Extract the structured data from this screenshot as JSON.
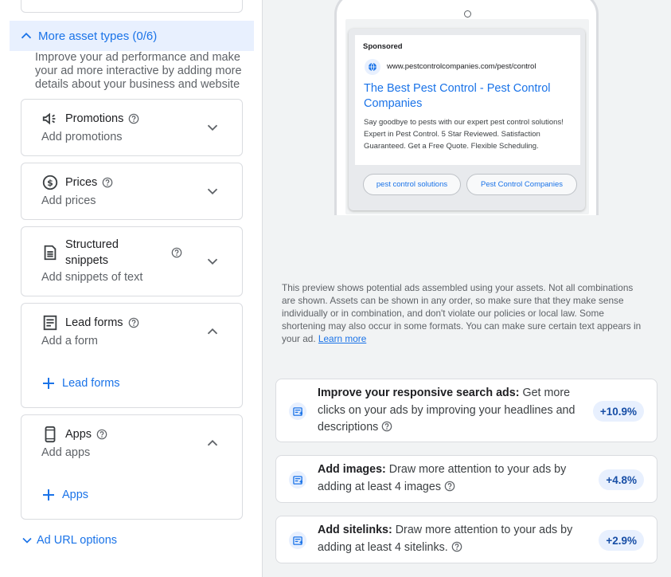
{
  "left": {
    "more_assets": {
      "label": "More asset types (0/6)",
      "description": "Improve your ad performance and make your ad more interactive by adding more details about your business and website"
    },
    "assets": [
      {
        "title": "Promotions",
        "sub": "Add promotions",
        "icon": "megaphone-icon"
      },
      {
        "title": "Prices",
        "sub": "Add prices",
        "icon": "dollar-circle-icon"
      },
      {
        "title": "Structured snippets",
        "sub": "Add snippets of text",
        "icon": "snippet-icon"
      },
      {
        "title": "Lead forms",
        "sub": "Add a form",
        "icon": "form-icon",
        "add_label": "Lead forms"
      },
      {
        "title": "Apps",
        "sub": "Add apps",
        "icon": "phone-icon",
        "add_label": "Apps"
      }
    ],
    "url_options": "Ad URL options"
  },
  "preview": {
    "sponsored": "Sponsored",
    "display_url": "www.pestcontrolcompanies.com/pest/control",
    "headline": "The Best Pest Control - Pest Control Companies",
    "description": "Say goodbye to pests with our expert pest control solutions! Expert in Pest Control. 5 Star Reviewed. Satisfaction Guaranteed. Get a Free Quote. Flexible Scheduling.",
    "sitelinks": [
      "pest control solutions",
      "Pest Control Companies"
    ],
    "disclaimer": "This preview shows potential ads assembled using your assets. Not all combinations are shown. Assets can be shown in any order, so make sure that they make sense individually or in combination, and don't violate our policies or local law. Some shortening may also occur in some formats. You can make sure certain text appears in your ad.",
    "learn_more": "Learn more"
  },
  "suggestions": [
    {
      "title": "Improve your responsive search ads:",
      "text": "Get more clicks on your ads by improving your headlines and descriptions",
      "badge": "+10.9%"
    },
    {
      "title": "Add images:",
      "text": "Draw more attention to your ads by adding at least 4 images",
      "badge": "+4.8%"
    },
    {
      "title": "Add sitelinks:",
      "text": "Draw more attention to your ads by adding at least 4 sitelinks.",
      "badge": "+2.9%"
    }
  ],
  "colors": {
    "accent": "#1a73e8",
    "header_bg": "#e8f0fe",
    "panel_bg": "#f1f3f4"
  }
}
